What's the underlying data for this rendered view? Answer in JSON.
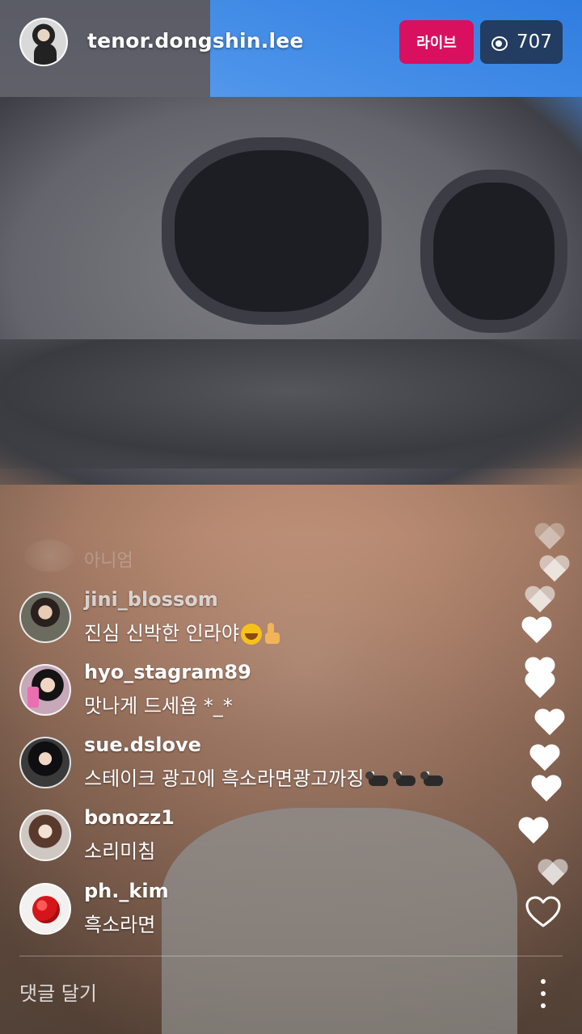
{
  "header": {
    "host_username": "tenor.dongshin.lee",
    "live_label": "라이브",
    "viewer_icon": "eye-icon",
    "viewer_count": "707"
  },
  "faded_comment": {
    "text": "아니엄"
  },
  "comments": [
    {
      "username": "jini_blossom",
      "text": "진심 신박한 인라야",
      "emoji": [
        "laughing-face",
        "thumbs-up"
      ]
    },
    {
      "username": "hyo_stagram89",
      "text": "맛나게 드세욥 *_*"
    },
    {
      "username": "sue.dslove",
      "text": "스테이크 광고에 흑소라면광고까징",
      "emoji": [
        "water-buffalo",
        "water-buffalo",
        "water-buffalo"
      ]
    },
    {
      "username": "bonozz1",
      "text": "소리미침"
    },
    {
      "username": "ph._kim",
      "text": "흑소라면"
    }
  ],
  "footer": {
    "comment_placeholder": "댓글 달기",
    "like_icon": "heart-outline-icon",
    "more_icon": "more-vertical-icon"
  },
  "colors": {
    "live_badge": "#d90f5f",
    "viewer_badge": "#1e283c"
  }
}
